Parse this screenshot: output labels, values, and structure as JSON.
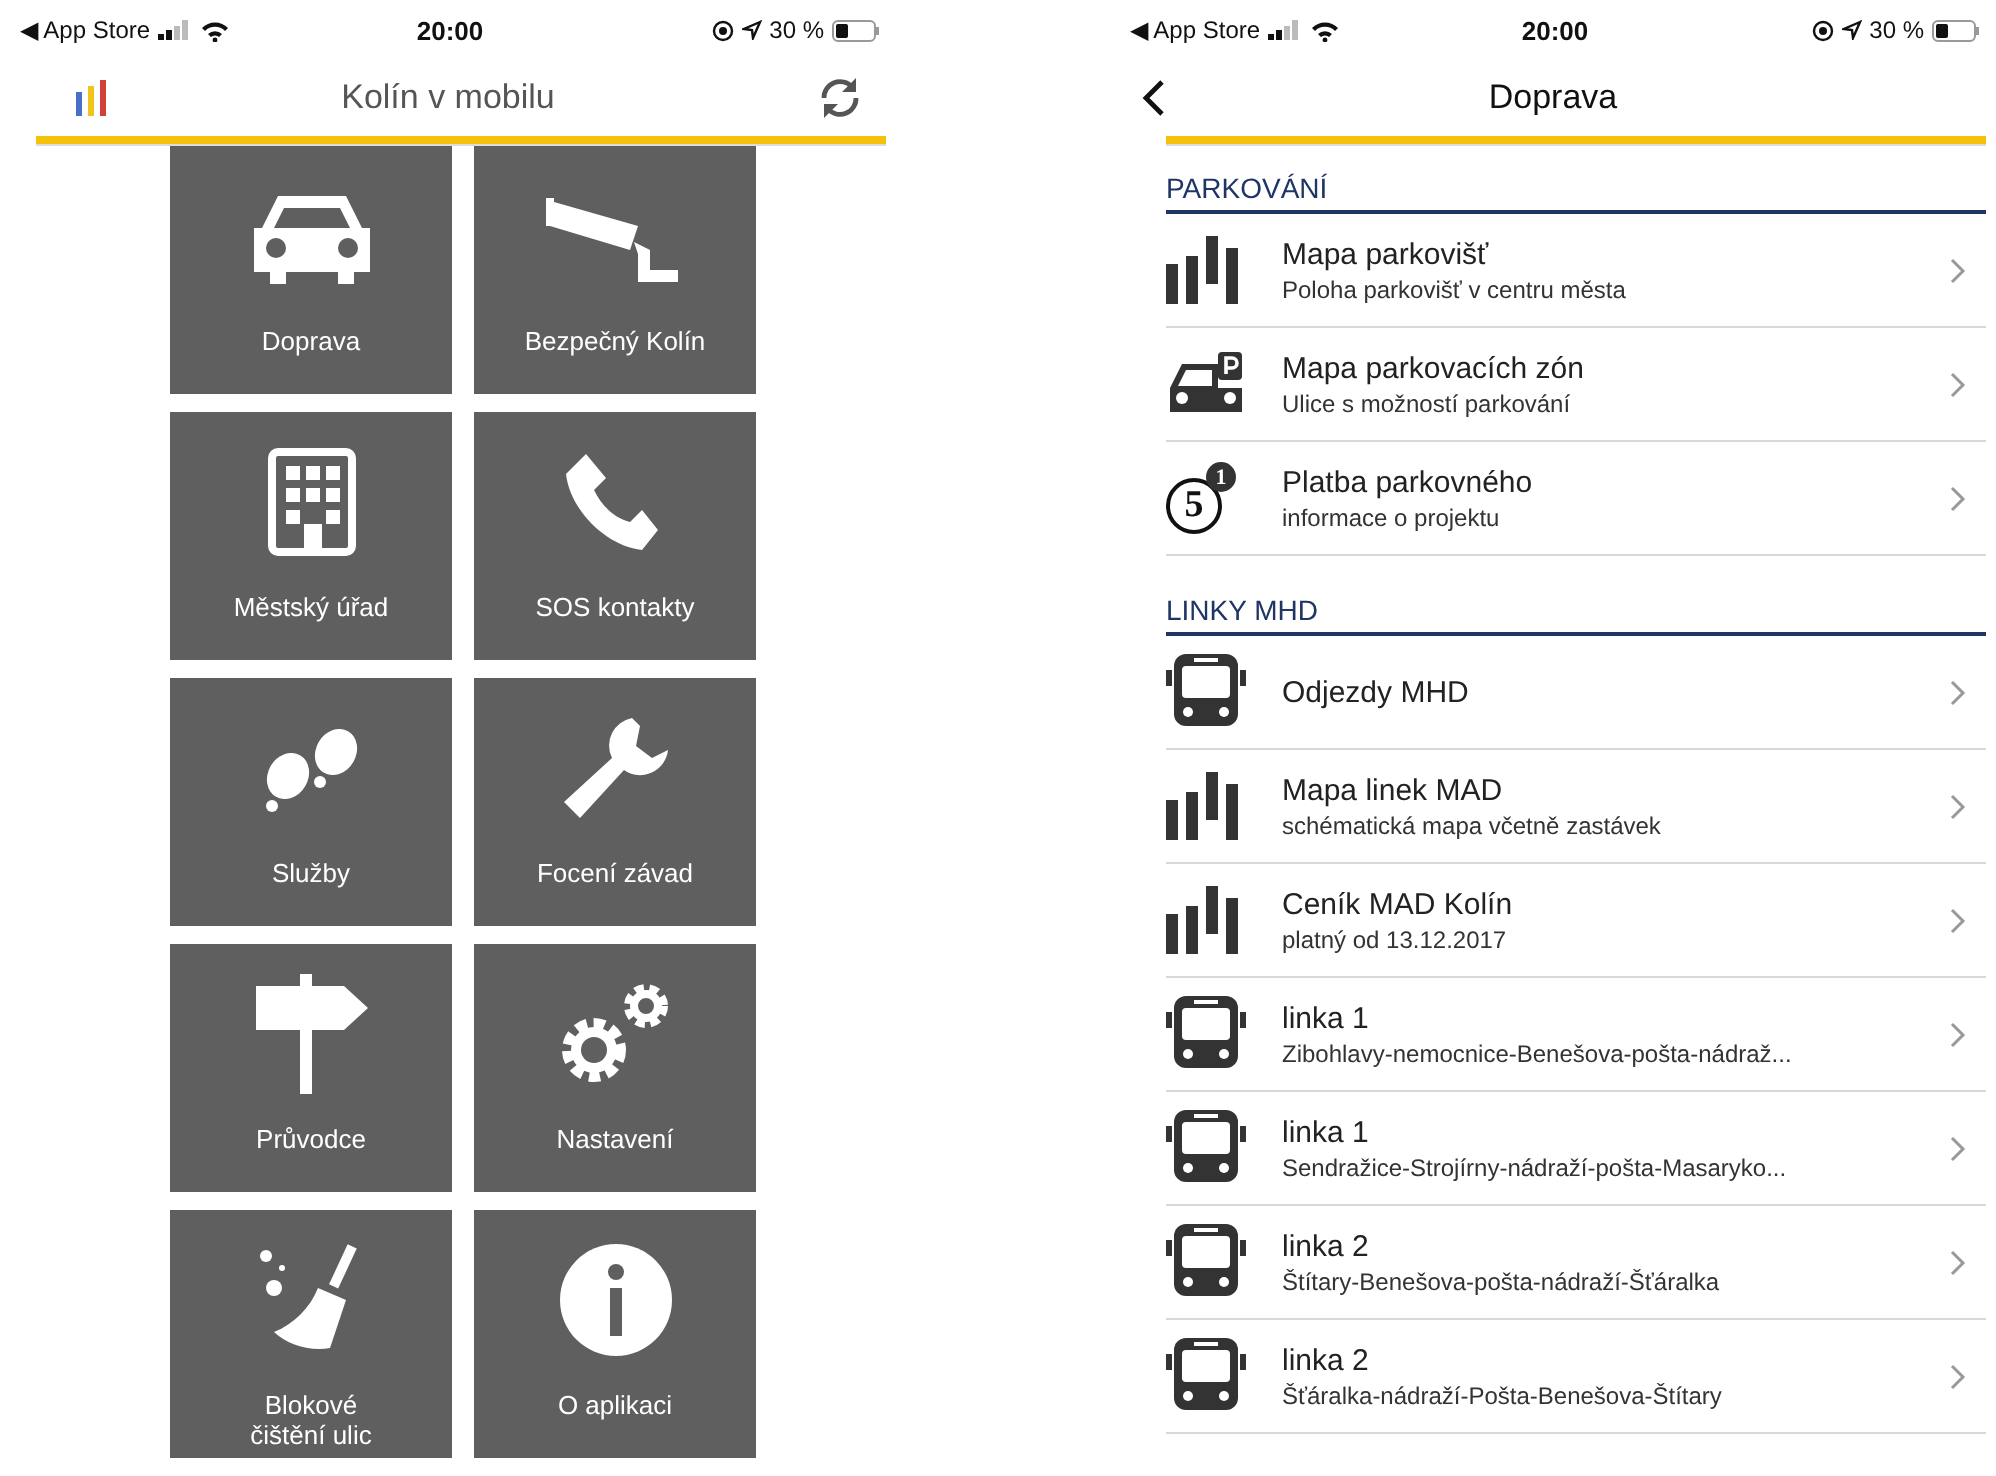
{
  "home_screen": {
    "status_bar": {
      "back_app": "◀ App Store",
      "time": "20:00",
      "battery": "30 %"
    },
    "nav": {
      "title": "Kolín v mobilu"
    },
    "tiles": [
      {
        "label": "Doprava"
      },
      {
        "label": "Bezpečný Kolín"
      },
      {
        "label": "Městský úřad"
      },
      {
        "label": "SOS kontakty"
      },
      {
        "label": "Služby"
      },
      {
        "label": "Focení závad"
      },
      {
        "label": "Průvodce"
      },
      {
        "label": "Nastavení"
      },
      {
        "label": "Blokové\nčištění ulic"
      },
      {
        "label": "O aplikaci"
      }
    ]
  },
  "detail_screen": {
    "status_bar": {
      "back_app": "◀ App Store",
      "time": "20:00",
      "battery": "30 %"
    },
    "nav": {
      "title": "Doprava"
    },
    "sections": [
      {
        "title": "PARKOVÁNÍ",
        "rows": [
          {
            "kind": "map",
            "title": "Mapa parkovišť",
            "subtitle": "Poloha parkovišť v centru města"
          },
          {
            "kind": "zone",
            "title": "Mapa parkovacích zón",
            "subtitle": "Ulice s možností parkování"
          },
          {
            "kind": "payment",
            "title": "Platba parkovného",
            "subtitle": "informace o projektu",
            "badge_main": "5",
            "badge_small": "1"
          }
        ]
      },
      {
        "title": "LINKY MHD",
        "rows": [
          {
            "kind": "route",
            "title": "Odjezdy MHD"
          },
          {
            "kind": "map",
            "title": "Mapa linek MAD",
            "subtitle": "schématická mapa včetně zastávek"
          },
          {
            "kind": "map",
            "title": "Ceník MAD Kolín",
            "subtitle": "platný od 13.12.2017"
          },
          {
            "kind": "route",
            "title": "linka 1",
            "subtitle": "Zibohlavy-nemocnice-Benešova-pošta-nádraž..."
          },
          {
            "kind": "route",
            "title": "linka 1",
            "subtitle": "Sendražice-Strojírny-nádraží-pošta-Masaryko..."
          },
          {
            "kind": "route",
            "title": "linka 2",
            "subtitle": "Štítary-Benešova-pošta-nádraží-Šťáralka"
          },
          {
            "kind": "route",
            "title": "linka 2",
            "subtitle": "Šťáralka-nádraží-Pošta-Benešova-Štítary"
          }
        ]
      }
    ]
  }
}
